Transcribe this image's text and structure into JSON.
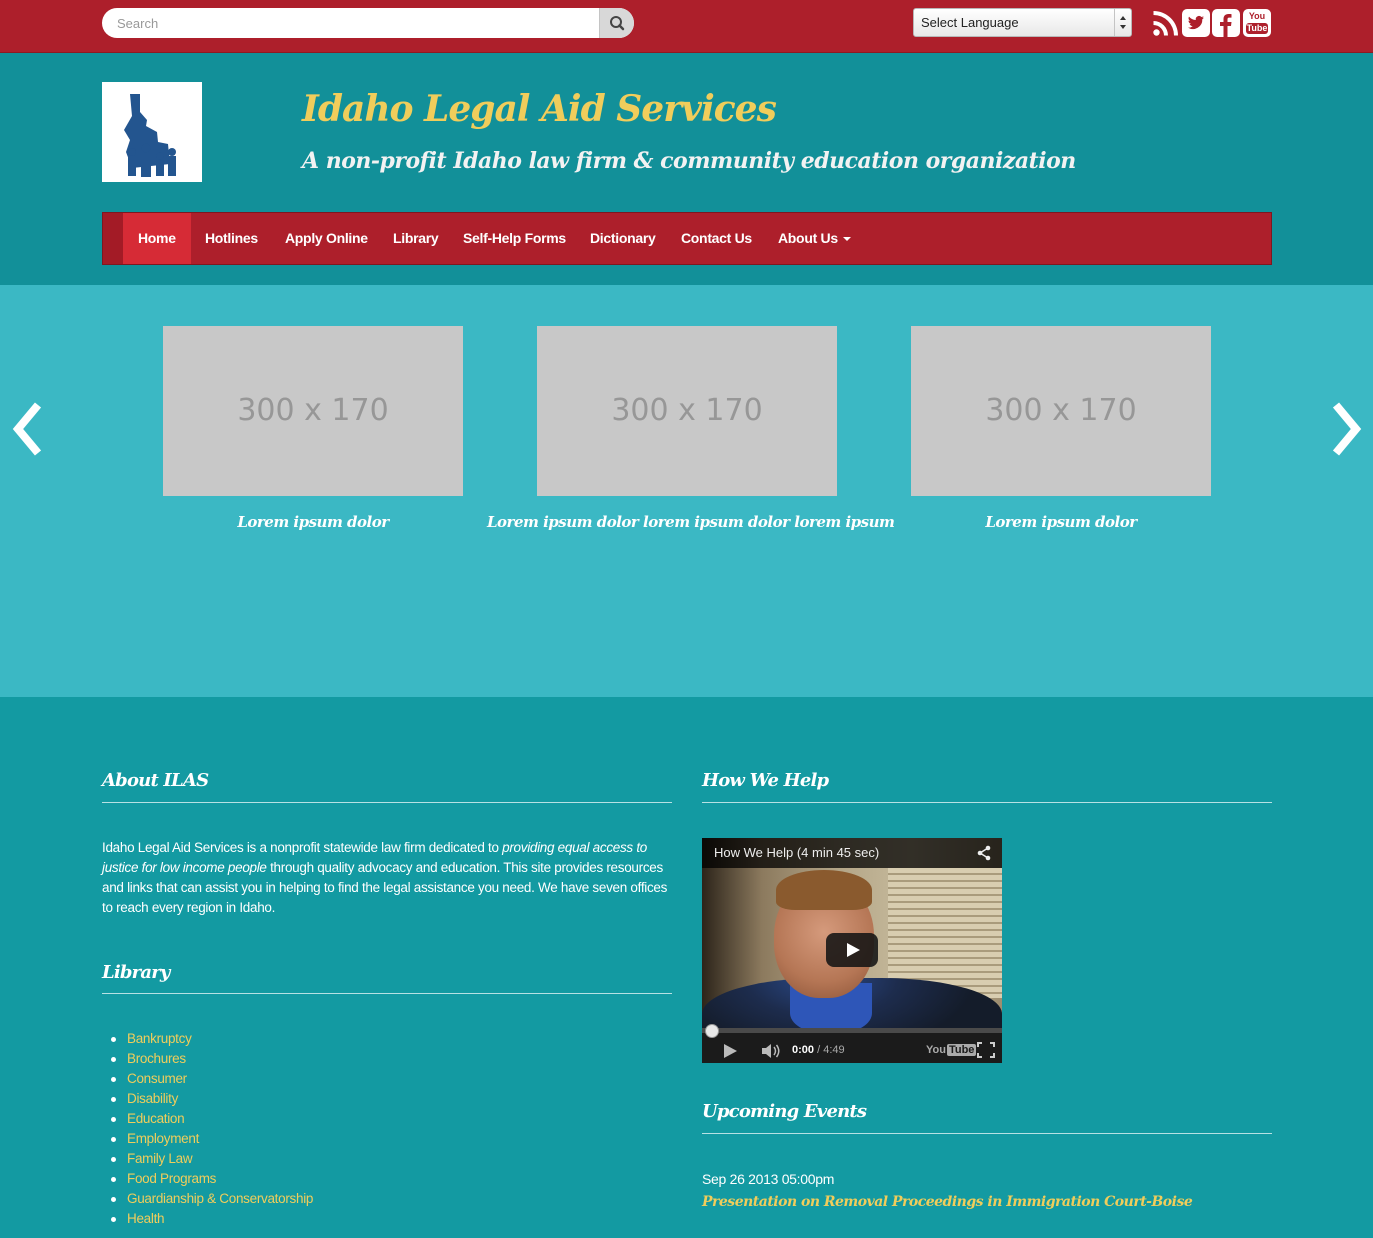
{
  "topbar": {
    "search_placeholder": "Search",
    "language_label": "Select Language",
    "social": [
      "rss-icon",
      "twitter-icon",
      "facebook-icon",
      "youtube-icon"
    ],
    "youtube_text_top": "You",
    "youtube_text_bottom": "Tube"
  },
  "header": {
    "title": "Idaho Legal Aid Services",
    "tagline": "A non-profit Idaho law firm & community education organization"
  },
  "nav": {
    "items": [
      "Home",
      "Hotlines",
      "Apply Online",
      "Library",
      "Self-Help Forms",
      "Dictionary",
      "Contact Us",
      "About Us"
    ]
  },
  "carousel": {
    "slides": [
      {
        "placeholder": "300 x 170",
        "caption": "Lorem ipsum dolor"
      },
      {
        "placeholder": "300 x 170",
        "caption": "Lorem ipsum dolor lorem ipsum dolor lorem ipsum"
      },
      {
        "placeholder": "300 x 170",
        "caption": "Lorem ipsum dolor"
      }
    ]
  },
  "about": {
    "title": "About ILAS",
    "text_1": "Idaho Legal Aid Services is a nonprofit statewide law firm dedicated to ",
    "text_em": "providing equal access to justice for low income people",
    "text_2": " through quality advocacy and education. This site provides resources and links that can assist you in helping to find the legal assistance you need. We have seven offices to reach every region in Idaho."
  },
  "library": {
    "title": "Library",
    "items": [
      "Bankruptcy",
      "Brochures",
      "Consumer",
      "Disability",
      "Education",
      "Employment",
      "Family Law",
      "Food Programs",
      "Guardianship & Conservatorship",
      "Health"
    ]
  },
  "how_we_help": {
    "title": "How We Help",
    "video_title": "How We Help (4 min 45 sec)",
    "current_time": "0:00",
    "duration": "/ 4:49",
    "yt_you": "You",
    "yt_tube": "Tube"
  },
  "events": {
    "title": "Upcoming Events",
    "items": [
      {
        "date": "Sep 26 2013 05:00pm",
        "title": "Presentation on Removal Proceedings in Immigration Court-Boise"
      }
    ]
  },
  "colors": {
    "topbar": "#ad1f2b",
    "header": "#129099",
    "carousel": "#3bb8c4",
    "accent_yellow": "#f0cd5b",
    "nav_active": "#d62b36"
  }
}
